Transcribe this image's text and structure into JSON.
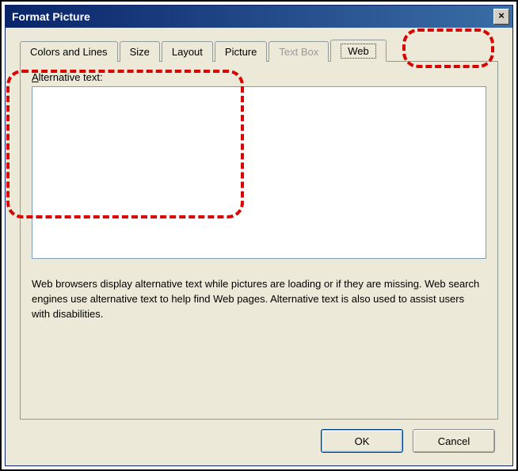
{
  "window": {
    "title": "Format Picture",
    "close_symbol": "×"
  },
  "tabs": [
    {
      "label": "Colors and Lines",
      "state": "normal"
    },
    {
      "label": "Size",
      "state": "normal"
    },
    {
      "label": "Layout",
      "state": "normal"
    },
    {
      "label": "Picture",
      "state": "normal"
    },
    {
      "label": "Text Box",
      "state": "disabled"
    },
    {
      "label": "Web",
      "state": "selected"
    }
  ],
  "panel": {
    "alt_label_underlined_char": "A",
    "alt_label_rest": "lternative text:",
    "alt_value": "",
    "help": "Web browsers display alternative text while pictures are loading or if they are missing.   Web search engines use alternative text to help find Web pages.  Alternative text is also used to assist users with disabilities."
  },
  "buttons": {
    "ok": "OK",
    "cancel": "Cancel"
  }
}
